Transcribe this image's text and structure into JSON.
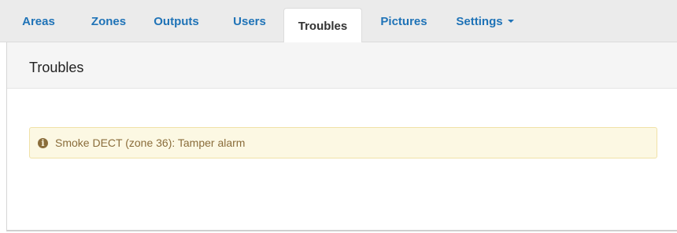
{
  "nav": {
    "tabs": [
      {
        "label": "Areas"
      },
      {
        "label": "Zones"
      },
      {
        "label": "Outputs"
      },
      {
        "label": "Users"
      },
      {
        "label": "Troubles",
        "active": true
      },
      {
        "label": "Pictures"
      },
      {
        "label": "Settings",
        "dropdown": true
      }
    ]
  },
  "panel": {
    "title": "Troubles",
    "alerts": [
      {
        "icon": "info-circle-icon",
        "text": "Smoke DECT (zone 36): Tamper alarm"
      }
    ]
  },
  "colors": {
    "link": "#1f73b7",
    "alert_bg": "#fcf8e3",
    "alert_text": "#8a6d3b"
  }
}
